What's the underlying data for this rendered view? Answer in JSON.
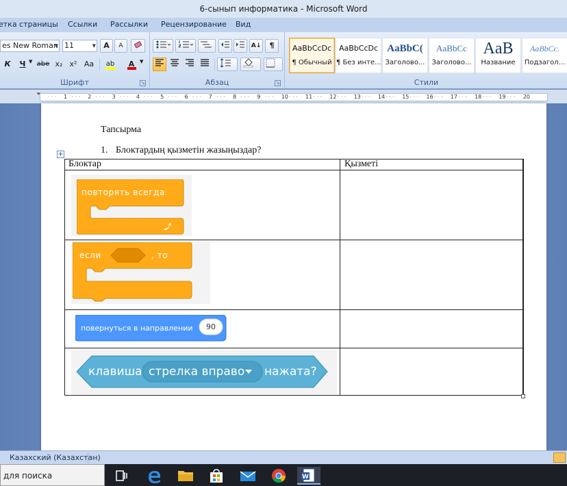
{
  "window": {
    "title": "6-сынып информатика - Microsoft Word"
  },
  "ribbon_tabs": [
    "етка страницы",
    "Ссылки",
    "Рассылки",
    "Рецензирование",
    "Вид"
  ],
  "font_group": {
    "font_name": "es New Roman",
    "font_size": "11",
    "label": "Шрифт",
    "grow_label": "A",
    "shrink_label": "A",
    "italic_label": "К",
    "underline_label": "Ч",
    "strike_label": "abe",
    "sub_label": "x₂",
    "sup_label": "x²",
    "case_label": "Aa",
    "highlight_label": "ab",
    "font_color_label": "A",
    "highlight_color": "#ffff00",
    "font_color": "#e00000"
  },
  "paragraph_group": {
    "label": "Абзац",
    "sort_label": "A↓",
    "pilcrow_label": "¶"
  },
  "styles_group": {
    "label": "Стили",
    "items": [
      {
        "sample": "AaBbCcDc",
        "name": "¶ Обычный"
      },
      {
        "sample": "AaBbCcDc",
        "name": "¶ Без инте..."
      },
      {
        "sample": "AaBbC(",
        "name": "Заголово..."
      },
      {
        "sample": "AaBbCc",
        "name": "Заголово..."
      },
      {
        "sample": "AaB",
        "name": "Название"
      },
      {
        "sample": "AaBbCc.",
        "name": "Подзагол..."
      }
    ]
  },
  "ruler": {
    "numbers": [
      "1",
      "2",
      "3",
      "4",
      "5",
      "6",
      "7",
      "8",
      "9",
      "10",
      "11",
      "12",
      "13",
      "14",
      "15",
      "16",
      "17",
      "18",
      "19",
      "20"
    ]
  },
  "document": {
    "heading": "Тапсырма",
    "question_number": "1.",
    "question": "Блоктардың қызметін жазыңыздар?",
    "table": {
      "headers": [
        "Блоктар",
        "Қызметі"
      ],
      "rows": [
        {
          "block_text": "повторять всегда",
          "block_color": "#ffab19"
        },
        {
          "block_text": "если",
          "block_text_2": ", то",
          "block_color": "#ffab19"
        },
        {
          "block_text": "повернуться в направлении",
          "value": "90",
          "block_color": "#4c97ff"
        },
        {
          "block_text": "клавиша",
          "dropdown": "стрелка вправо",
          "block_text_2": "нажата?",
          "block_color": "#5cb1d6"
        }
      ]
    }
  },
  "status_bar": {
    "language": "Казахский (Казахстан)"
  },
  "taskbar": {
    "search_placeholder": "для поиска"
  }
}
